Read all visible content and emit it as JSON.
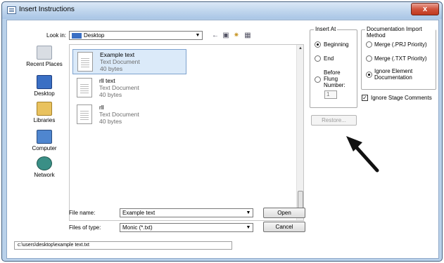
{
  "window": {
    "title": "Insert Instructions",
    "close_symbol": "x"
  },
  "look_in": {
    "label": "Look in:",
    "value": "Desktop"
  },
  "places": [
    {
      "label": "Recent Places"
    },
    {
      "label": "Desktop"
    },
    {
      "label": "Libraries"
    },
    {
      "label": "Computer"
    },
    {
      "label": "Network"
    }
  ],
  "files": [
    {
      "name": "Example text",
      "type": "Text Document",
      "size": "40 bytes"
    },
    {
      "name": "rll text",
      "type": "Text Document",
      "size": "40 bytes"
    },
    {
      "name": "rll",
      "type": "Text Document",
      "size": "40 bytes"
    }
  ],
  "file_name": {
    "label": "File name:",
    "value": "Example text"
  },
  "files_of_type": {
    "label": "Files of type:",
    "value": "Monic (*.txt)"
  },
  "buttons": {
    "open": "Open",
    "cancel": "Cancel",
    "restore": "Restore..."
  },
  "status_path": "c:\\users\\desktop\\example text.txt",
  "insert_at": {
    "legend": "Insert At",
    "options": [
      "Beginning",
      "End"
    ],
    "before_lines": [
      "Before",
      "Flung",
      "Number:"
    ],
    "number_value": "1",
    "selected": "Beginning"
  },
  "doc_import": {
    "legend": "Documentation Import Method",
    "options": [
      "Merge (.PRJ Priority)",
      "Merge (.TXT Priority)"
    ],
    "ignore_lines": [
      "Ignore Element",
      "Documentation"
    ],
    "selected": "Ignore Element Documentation"
  },
  "ignore_stage_comments": {
    "label": "Ignore Stage Comments",
    "checked": true
  }
}
